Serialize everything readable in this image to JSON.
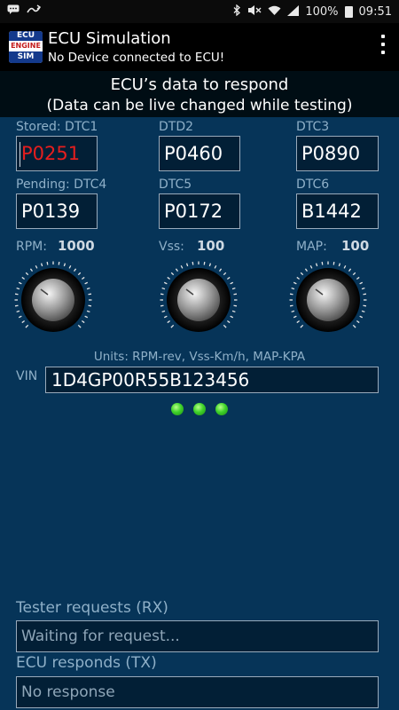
{
  "status_bar": {
    "battery": "100%",
    "time": "09:51",
    "icons": [
      "message-icon",
      "transfer-icon",
      "bluetooth-icon",
      "mute-icon",
      "wifi-icon",
      "signal-icon",
      "battery-icon"
    ]
  },
  "app_bar": {
    "logo_line1": "ECU",
    "logo_line2": "ENGINE",
    "logo_line3": "SIM",
    "title": "ECU Simulation",
    "subtitle": "No Device connected to ECU!"
  },
  "banner": {
    "line1": "ECU’s data to respond",
    "line2": "(Data can be live changed while testing)"
  },
  "dtc": {
    "stored_label": "Stored: DTC1",
    "stored_value": "P0251",
    "dtc2_label": "DTD2",
    "dtc2_value": "P0460",
    "dtc3_label": "DTC3",
    "dtc3_value": "P0890",
    "pending_label": "Pending: DTC4",
    "pending_value": "P0139",
    "dtc5_label": "DTC5",
    "dtc5_value": "P0172",
    "dtc6_label": "DTC6",
    "dtc6_value": "B1442"
  },
  "knobs": {
    "rpm_label": "RPM:",
    "rpm_value": "1000",
    "vss_label": "Vss:",
    "vss_value": "100",
    "map_label": "MAP:",
    "map_value": "100"
  },
  "units": "Units: RPM-rev, Vss-Km/h, MAP-KPA",
  "vin": {
    "label": "VIN",
    "value": "1D4GP00R55B123456"
  },
  "tester": {
    "label": "Tester requests  (RX)",
    "value": "Waiting for request..."
  },
  "ecu": {
    "label": "ECU responds (TX)",
    "value": "No response"
  },
  "colors": {
    "background": "#063458",
    "stored_dtc_text": "#e61e1e",
    "led": "#3fd22a"
  }
}
